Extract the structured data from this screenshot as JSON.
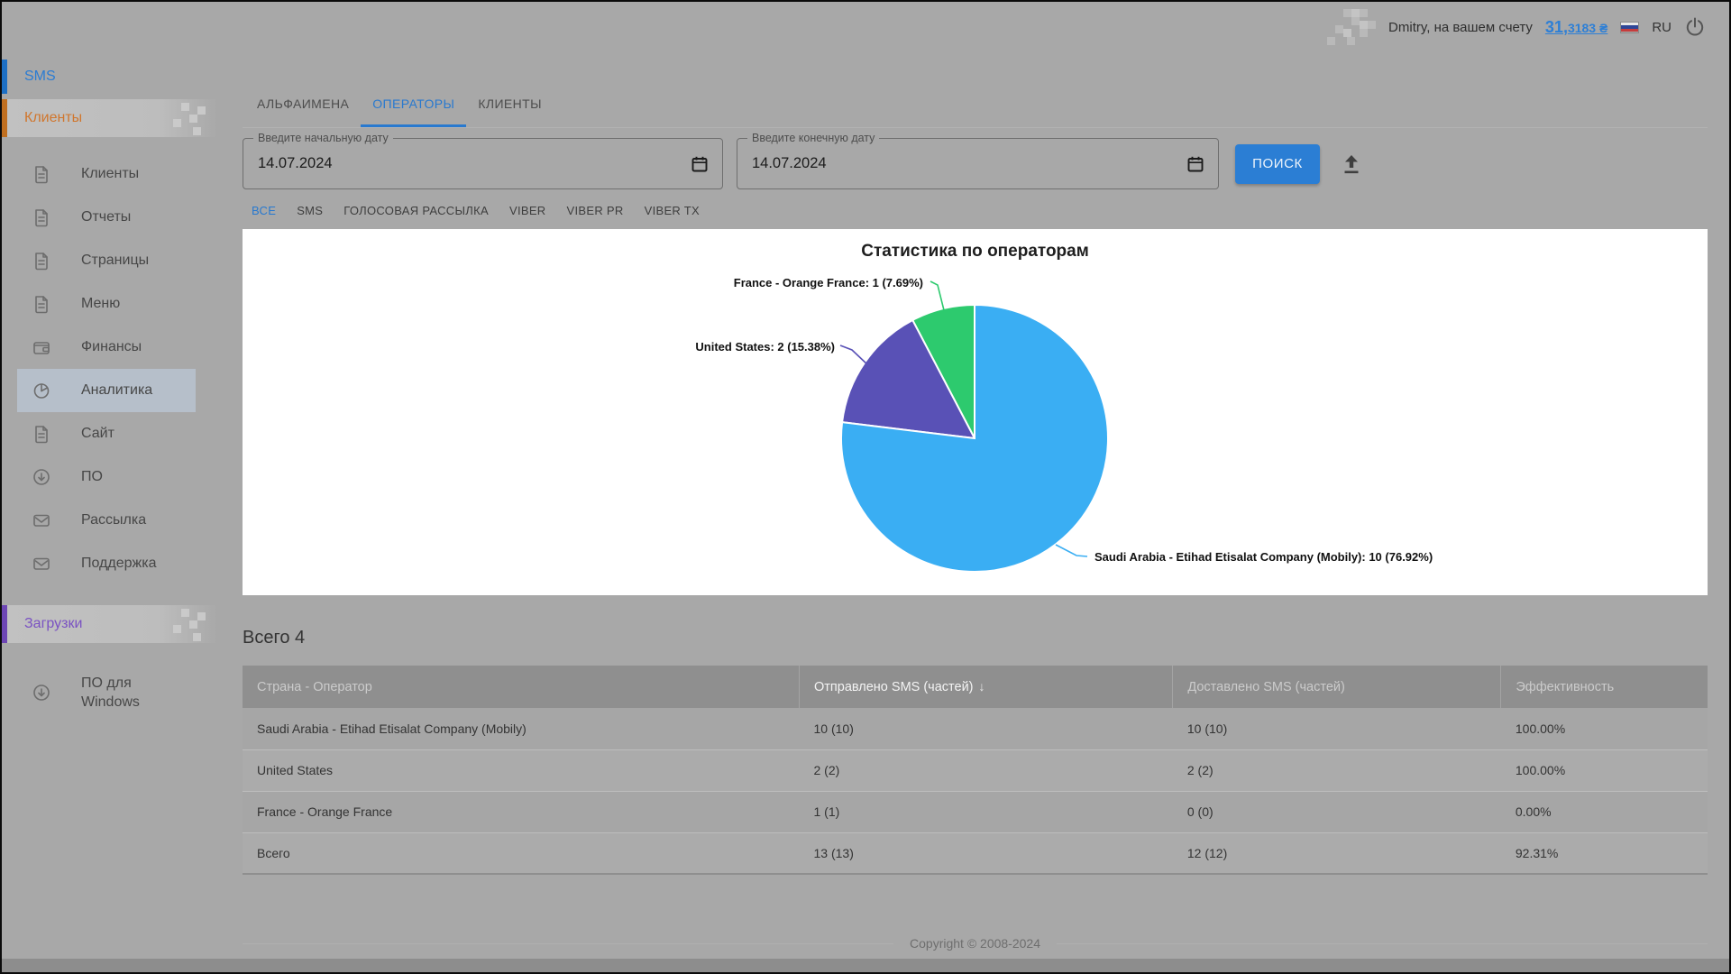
{
  "topbar": {
    "user_text": "Dmitry, на вашем счету",
    "balance_int": "31,",
    "balance_frac": "3183 ₴",
    "lang": "RU"
  },
  "sidebar": {
    "sms_section": "SMS",
    "clients_section": "Клиенты",
    "downloads_section": "Загрузки",
    "items": [
      {
        "label": "Клиенты"
      },
      {
        "label": "Отчеты"
      },
      {
        "label": "Страницы"
      },
      {
        "label": "Меню"
      },
      {
        "label": "Финансы"
      },
      {
        "label": "Аналитика"
      },
      {
        "label": "Сайт"
      },
      {
        "label": "ПО"
      },
      {
        "label": "Рассылка"
      },
      {
        "label": "Поддержка"
      }
    ],
    "downloads_item_line1": "ПО для",
    "downloads_item_line2": "Windows"
  },
  "tabs": [
    {
      "label": "АЛЬФАИМЕНА"
    },
    {
      "label": "ОПЕРАТОРЫ"
    },
    {
      "label": "КЛИЕНТЫ"
    }
  ],
  "filters": {
    "start_label": "Введите начальную дату",
    "start_value": "14.07.2024",
    "end_label": "Введите конечную дату",
    "end_value": "14.07.2024",
    "search_button": "ПОИСК",
    "types": [
      "ВСЕ",
      "SMS",
      "ГОЛОСОВАЯ РАССЫЛКА",
      "VIBER",
      "VIBER PR",
      "VIBER TX"
    ]
  },
  "chart_data": {
    "type": "pie",
    "title": "Статистика по операторам",
    "legend_position": "callout-labels",
    "series": [
      {
        "label": "Saudi Arabia - Etihad Etisalat Company (Mobily)",
        "value": 10,
        "percent": 76.92,
        "color": "#3AAEF3",
        "callout": "Saudi Arabia - Etihad Etisalat Company (Mobily): 10 (76.92%)"
      },
      {
        "label": "United States",
        "value": 2,
        "percent": 15.38,
        "color": "#5951B6",
        "callout": "United States: 2 (15.38%)"
      },
      {
        "label": "France - Orange France",
        "value": 1,
        "percent": 7.69,
        "color": "#2DCA6E",
        "callout": "France - Orange France: 1 (7.69%)"
      }
    ]
  },
  "table": {
    "total_label": "Всего 4",
    "columns": [
      "Страна - Оператор",
      "Отправлено SMS (частей)",
      "Доставлено SMS (частей)",
      "Эффективность"
    ],
    "sort_column": "Отправлено SMS (частей)",
    "sort_arrow": "↓",
    "rows": [
      [
        "Saudi Arabia - Etihad Etisalat Company (Mobily)",
        "10 (10)",
        "10 (10)",
        "100.00%"
      ],
      [
        "United States",
        "2 (2)",
        "2 (2)",
        "100.00%"
      ],
      [
        "France - Orange France",
        "1 (1)",
        "0 (0)",
        "0.00%"
      ],
      [
        "Всего",
        "13 (13)",
        "12 (12)",
        "92.31%"
      ]
    ]
  },
  "footer": {
    "copyright": "Copyright © 2008-2024"
  }
}
